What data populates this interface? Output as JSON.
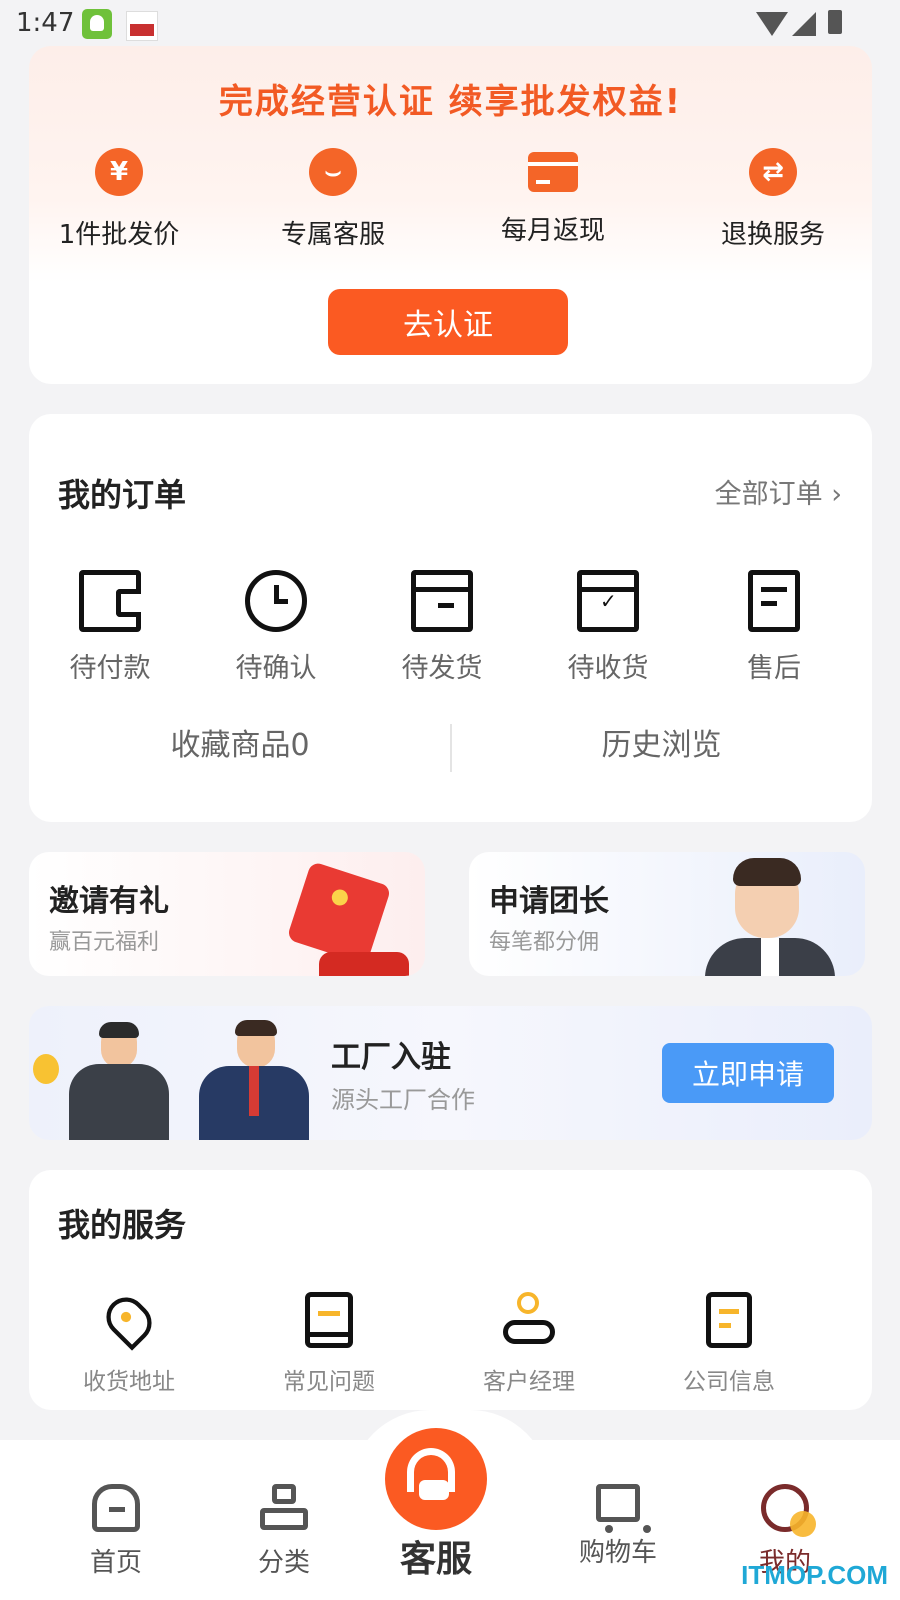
{
  "status_bar": {
    "time": "1:47"
  },
  "certification": {
    "title": "完成经营认证 续享批发权益!",
    "benefits": [
      {
        "icon": "yen-icon",
        "glyph": "¥",
        "label": "1件批发价"
      },
      {
        "icon": "smile-icon",
        "glyph": "⌣",
        "label": "专属客服"
      },
      {
        "icon": "card-icon",
        "glyph": "",
        "label": "每月返现"
      },
      {
        "icon": "exchange-icon",
        "glyph": "⇄",
        "label": "退换服务"
      }
    ],
    "button_label": "去认证"
  },
  "orders": {
    "title": "我的订单",
    "all_label": "全部订单",
    "items": [
      {
        "icon": "wallet-icon",
        "label": "待付款"
      },
      {
        "icon": "clock-icon",
        "label": "待确认"
      },
      {
        "icon": "box-icon",
        "label": "待发货"
      },
      {
        "icon": "box-check-icon",
        "label": "待收货"
      },
      {
        "icon": "document-icon",
        "label": "售后"
      }
    ],
    "favorites_label": "收藏商品0",
    "history_label": "历史浏览"
  },
  "promos": {
    "invite": {
      "title": "邀请有礼",
      "subtitle": "赢百元福利"
    },
    "leader": {
      "title": "申请团长",
      "subtitle": "每笔都分佣"
    }
  },
  "factory": {
    "title": "工厂入驻",
    "subtitle": "源头工厂合作",
    "button_label": "立即申请"
  },
  "services": {
    "title": "我的服务",
    "items": [
      {
        "icon": "location-pin-icon",
        "label": "收货地址"
      },
      {
        "icon": "book-icon",
        "label": "常见问题"
      },
      {
        "icon": "account-manager-icon",
        "label": "客户经理"
      },
      {
        "icon": "company-info-icon",
        "label": "公司信息"
      }
    ]
  },
  "tabbar": {
    "home": "首页",
    "category": "分类",
    "service": "客服",
    "cart": "购物车",
    "mine": "我的"
  },
  "watermark": "ITMOP.COM",
  "colors": {
    "accent_orange": "#fb5a22",
    "apply_blue": "#4a9af7",
    "service_yellow": "#f7b52b"
  }
}
